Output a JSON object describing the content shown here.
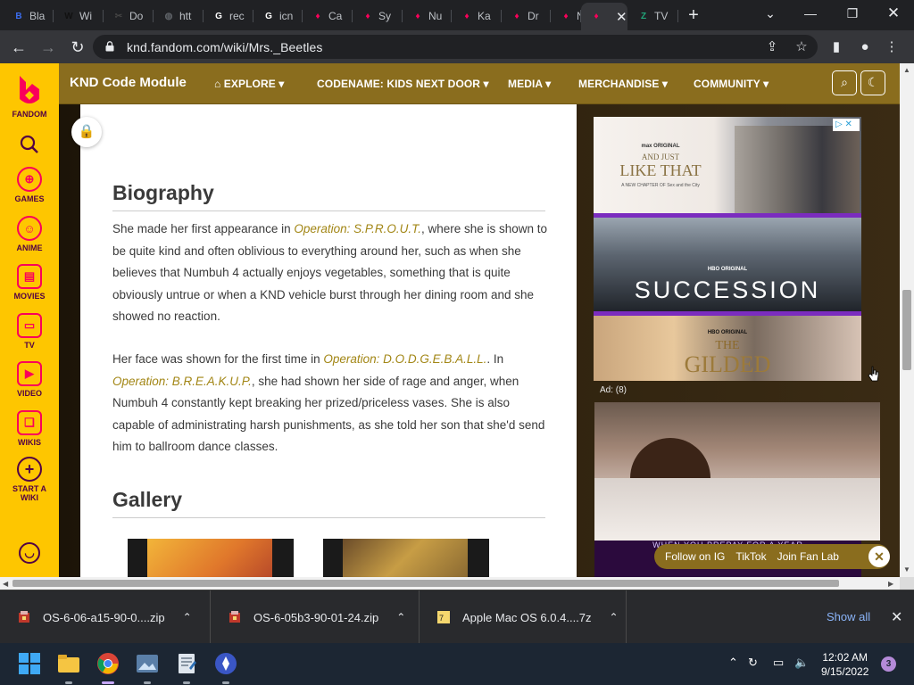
{
  "browser": {
    "tabs": [
      {
        "label": "Bla",
        "fav": "B",
        "color": "#3b6df0"
      },
      {
        "label": "Wi",
        "fav": "W",
        "color": "#111111"
      },
      {
        "label": "Do",
        "fav": "✂",
        "color": "#444444"
      },
      {
        "label": "htt",
        "fav": "◍",
        "color": "#5f6368"
      },
      {
        "label": "rec",
        "fav": "G",
        "color": "#ffffff"
      },
      {
        "label": "icn",
        "fav": "G",
        "color": "#ffffff"
      },
      {
        "label": "Ca",
        "fav": "♦",
        "color": "#fa005a"
      },
      {
        "label": "Sy",
        "fav": "♦",
        "color": "#fa005a"
      },
      {
        "label": "Nu",
        "fav": "♦",
        "color": "#fa005a"
      },
      {
        "label": "Ka",
        "fav": "♦",
        "color": "#fa005a"
      },
      {
        "label": "Dr",
        "fav": "♦",
        "color": "#fa005a"
      },
      {
        "label": "Nu",
        "fav": "♦",
        "color": "#fa005a"
      },
      {
        "label": "",
        "fav": "♦",
        "color": "#fa005a",
        "active": true
      },
      {
        "label": "TV",
        "fav": "Z",
        "color": "#21a67a"
      }
    ],
    "url": "knd.fandom.com/wiki/Mrs._Beetles"
  },
  "fandom": {
    "rail": [
      {
        "label": "FANDOM",
        "icon": "fandom-logo-icon"
      },
      {
        "label": "",
        "icon": "search-icon"
      },
      {
        "label": "GAMES",
        "icon": "games-icon"
      },
      {
        "label": "ANIME",
        "icon": "anime-icon"
      },
      {
        "label": "MOVIES",
        "icon": "movies-icon"
      },
      {
        "label": "TV",
        "icon": "tv-icon"
      },
      {
        "label": "VIDEO",
        "icon": "video-icon"
      },
      {
        "label": "WIKIS",
        "icon": "wikis-icon"
      },
      {
        "label": "START A WIKI",
        "icon": "plus-circle-icon"
      }
    ],
    "wiki_name": "KND Code Module",
    "nav": [
      "EXPLORE",
      "CODENAME: KIDS NEXT DOOR",
      "MEDIA",
      "MERCHANDISE",
      "COMMUNITY"
    ]
  },
  "article": {
    "biography_heading": "Biography",
    "p1": {
      "a": "She made her first appearance in ",
      "link1": "Operation: S.P.R.O.U.T.",
      "b": ", where she is shown to be quite kind and often oblivious to everything around her, such as when she believes that Numbuh 4 actually enjoys vegetables, something that is quite obviously untrue or when a KND vehicle burst through her dining room and she showed no reaction."
    },
    "p2": {
      "a": "Her face was shown for the first time in ",
      "link1": "Operation: D.O.D.G.E.B.A.L.L.",
      "b": ". In ",
      "link2": "Operation: B.R.E.A.K.U.P.",
      "c": ", she had shown her side of rage and anger, when Numbuh 4 constantly kept breaking her prized/priceless vases. She is also capable of administrating harsh punishments, as she told her son that she'd send him to ballroom dance classes."
    },
    "gallery_heading": "Gallery"
  },
  "ads": {
    "ad1_brand1": "max ORIGINAL",
    "ad1_title1a": "AND JUST",
    "ad1_title1b": "LIKE THAT",
    "ad1_sub1": "A NEW CHAPTER OF Sex and the City",
    "ad1_brand2": "HBO ORIGINAL",
    "ad1_title2": "SUCCESSION",
    "ad1_brand3": "HBO ORIGINAL",
    "ad1_title3a": "THE",
    "ad1_title3b": "GILDED",
    "ad_label": "Ad: (8)",
    "ad2_caption": "WHEN YOU PREPAY FOR A YEAR",
    "social": [
      "Follow on IG",
      "TikTok",
      "Join Fan Lab"
    ]
  },
  "downloads": [
    {
      "name": "OS-6-06-a15-90-0....zip"
    },
    {
      "name": "OS-6-05b3-90-01-24.zip"
    },
    {
      "name": "Apple Mac OS 6.0.4....7z"
    }
  ],
  "shelf": {
    "show_all": "Show all"
  },
  "taskbar": {
    "time": "12:02 AM",
    "date": "9/15/2022",
    "notifications": "3"
  }
}
